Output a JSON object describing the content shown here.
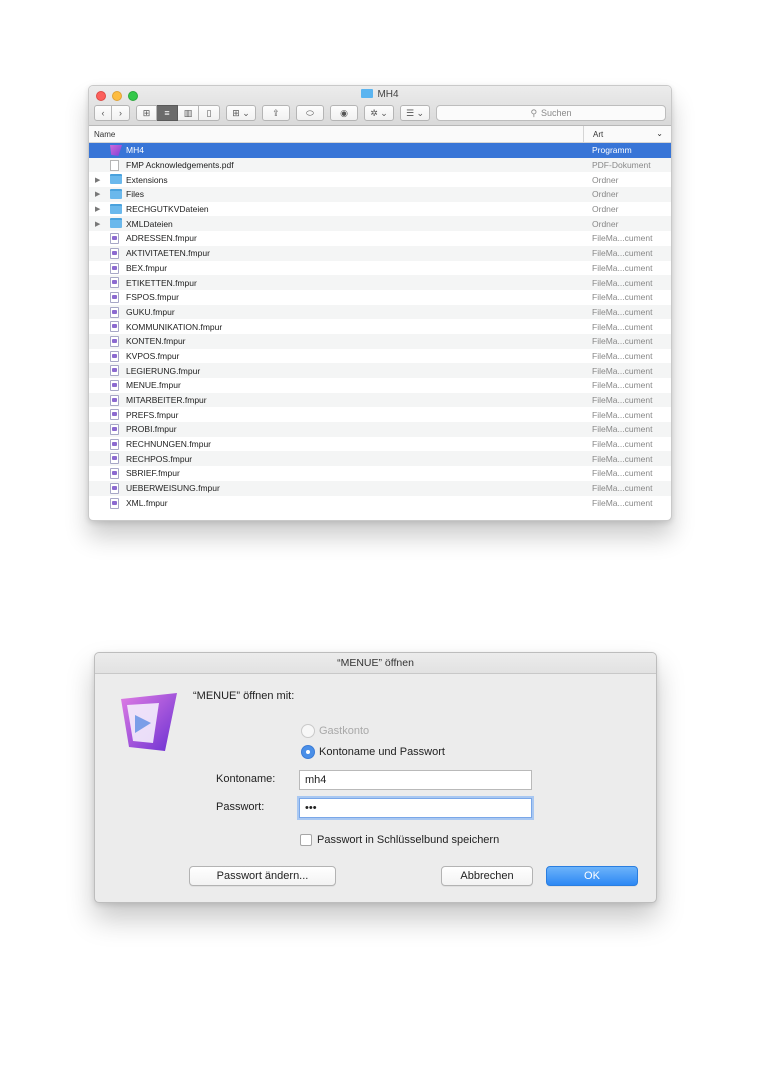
{
  "finder": {
    "title": "MH4",
    "search_placeholder": "Suchen",
    "columns": {
      "name": "Name",
      "kind": "Art"
    },
    "rows": [
      {
        "name": "MH4",
        "kind": "Programm",
        "icon": "app-icon",
        "disclosure": false,
        "selected": true
      },
      {
        "name": "FMP Acknowledgements.pdf",
        "kind": "PDF-Dokument",
        "icon": "pdf-icon",
        "disclosure": false
      },
      {
        "name": "Extensions",
        "kind": "Ordner",
        "icon": "folder-icon",
        "disclosure": true
      },
      {
        "name": "Files",
        "kind": "Ordner",
        "icon": "folder-icon",
        "disclosure": true
      },
      {
        "name": "RECHGUTKVDateien",
        "kind": "Ordner",
        "icon": "folder-icon",
        "disclosure": true
      },
      {
        "name": "XMLDateien",
        "kind": "Ordner",
        "icon": "folder-icon",
        "disclosure": true
      },
      {
        "name": "ADRESSEN.fmpur",
        "kind": "FileMa...cument",
        "icon": "document-icon"
      },
      {
        "name": "AKTIVITAETEN.fmpur",
        "kind": "FileMa...cument",
        "icon": "document-icon"
      },
      {
        "name": "BEX.fmpur",
        "kind": "FileMa...cument",
        "icon": "document-icon"
      },
      {
        "name": "ETIKETTEN.fmpur",
        "kind": "FileMa...cument",
        "icon": "document-icon"
      },
      {
        "name": "FSPOS.fmpur",
        "kind": "FileMa...cument",
        "icon": "document-icon"
      },
      {
        "name": "GUKU.fmpur",
        "kind": "FileMa...cument",
        "icon": "document-icon"
      },
      {
        "name": "KOMMUNIKATION.fmpur",
        "kind": "FileMa...cument",
        "icon": "document-icon"
      },
      {
        "name": "KONTEN.fmpur",
        "kind": "FileMa...cument",
        "icon": "document-icon"
      },
      {
        "name": "KVPOS.fmpur",
        "kind": "FileMa...cument",
        "icon": "document-icon"
      },
      {
        "name": "LEGIERUNG.fmpur",
        "kind": "FileMa...cument",
        "icon": "document-icon"
      },
      {
        "name": "MENUE.fmpur",
        "kind": "FileMa...cument",
        "icon": "document-icon"
      },
      {
        "name": "MITARBEITER.fmpur",
        "kind": "FileMa...cument",
        "icon": "document-icon"
      },
      {
        "name": "PREFS.fmpur",
        "kind": "FileMa...cument",
        "icon": "document-icon"
      },
      {
        "name": "PROBI.fmpur",
        "kind": "FileMa...cument",
        "icon": "document-icon"
      },
      {
        "name": "RECHNUNGEN.fmpur",
        "kind": "FileMa...cument",
        "icon": "document-icon"
      },
      {
        "name": "RECHPOS.fmpur",
        "kind": "FileMa...cument",
        "icon": "document-icon"
      },
      {
        "name": "SBRIEF.fmpur",
        "kind": "FileMa...cument",
        "icon": "document-icon"
      },
      {
        "name": "UEBERWEISUNG.fmpur",
        "kind": "FileMa...cument",
        "icon": "document-icon"
      },
      {
        "name": "XML.fmpur",
        "kind": "FileMa...cument",
        "icon": "document-icon"
      }
    ]
  },
  "dialog": {
    "title": "“MENUE” öffnen",
    "open_with_label": "“MENUE” öffnen mit:",
    "radio_guest": "Gastkonto",
    "radio_account": "Kontoname und Passwort",
    "account_label": "Kontoname:",
    "account_value": "mh4",
    "password_label": "Passwort:",
    "password_value": "•••",
    "keychain_label": "Passwort in Schlüsselbund speichern",
    "change_password_button": "Passwort ändern...",
    "cancel_button": "Abbrechen",
    "ok_button": "OK"
  },
  "colors": {
    "selection": "#3875d7",
    "default_button": "#2d88f4",
    "folder": "#6ab8ec"
  }
}
